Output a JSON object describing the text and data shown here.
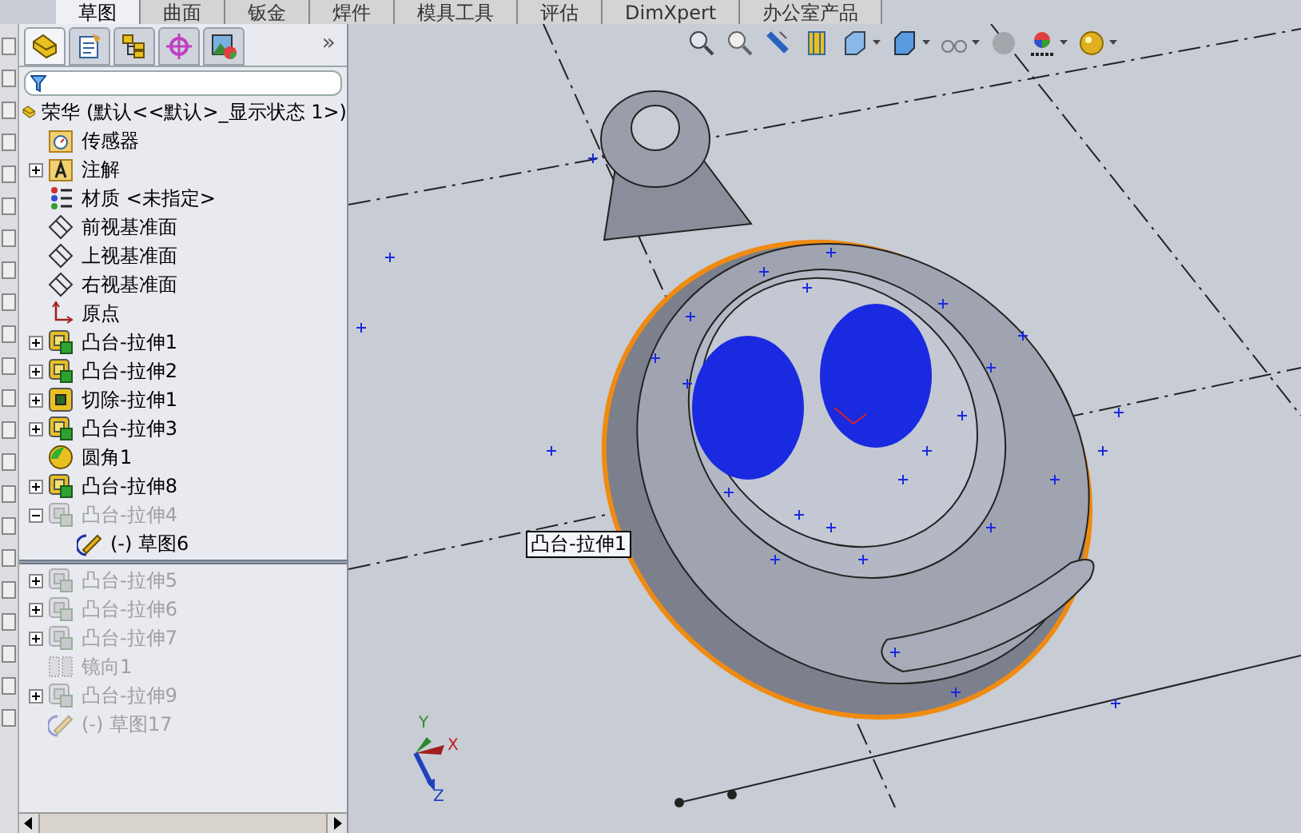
{
  "command_tabs": [
    {
      "label": "草图",
      "selected": true
    },
    {
      "label": "曲面",
      "selected": false
    },
    {
      "label": "钣金",
      "selected": false
    },
    {
      "label": "焊件",
      "selected": false
    },
    {
      "label": "模具工具",
      "selected": false
    },
    {
      "label": "评估",
      "selected": false
    },
    {
      "label": "DimXpert",
      "selected": false
    },
    {
      "label": "办公室产品",
      "selected": false
    }
  ],
  "panel_tabs": [
    {
      "kind": "feature",
      "selected": true
    },
    {
      "kind": "property",
      "selected": false
    },
    {
      "kind": "config",
      "selected": false
    },
    {
      "kind": "dimxpert",
      "selected": false
    },
    {
      "kind": "display",
      "selected": false
    }
  ],
  "panel_more": "»",
  "tree": {
    "label": "荣华 (默认<<默认>_显示状态 1>)",
    "kind": "part",
    "children": [
      {
        "label": "传感器",
        "kind": "sensor",
        "suppressed": false
      },
      {
        "label": "注解",
        "kind": "annotation",
        "expanded": false,
        "suppressed": false
      },
      {
        "label": "材质 <未指定>",
        "kind": "material",
        "suppressed": false
      },
      {
        "label": "前视基准面",
        "kind": "plane",
        "suppressed": false
      },
      {
        "label": "上视基准面",
        "kind": "plane",
        "suppressed": false
      },
      {
        "label": "右视基准面",
        "kind": "plane",
        "suppressed": false
      },
      {
        "label": "原点",
        "kind": "origin",
        "suppressed": false
      },
      {
        "label": "凸台-拉伸1",
        "kind": "boss",
        "expanded": false,
        "suppressed": false
      },
      {
        "label": "凸台-拉伸2",
        "kind": "boss",
        "expanded": false,
        "suppressed": false
      },
      {
        "label": "切除-拉伸1",
        "kind": "cut",
        "expanded": false,
        "suppressed": false
      },
      {
        "label": "凸台-拉伸3",
        "kind": "boss",
        "expanded": false,
        "suppressed": false
      },
      {
        "label": "圆角1",
        "kind": "fillet",
        "suppressed": false
      },
      {
        "label": "凸台-拉伸8",
        "kind": "boss",
        "expanded": false,
        "suppressed": false
      },
      {
        "label": "凸台-拉伸4",
        "kind": "boss",
        "expanded": true,
        "suppressed": true,
        "rollback_bar_after": true,
        "children": [
          {
            "label": "(-) 草图6",
            "kind": "sketch",
            "suppressed": false
          }
        ]
      },
      {
        "label": "凸台-拉伸5",
        "kind": "boss",
        "expanded": false,
        "suppressed": true
      },
      {
        "label": "凸台-拉伸6",
        "kind": "boss",
        "expanded": false,
        "suppressed": true
      },
      {
        "label": "凸台-拉伸7",
        "kind": "boss",
        "expanded": false,
        "suppressed": true
      },
      {
        "label": "镜向1",
        "kind": "mirror",
        "suppressed": true
      },
      {
        "label": "凸台-拉伸9",
        "kind": "boss",
        "expanded": false,
        "suppressed": true
      },
      {
        "label": "(-) 草图17",
        "kind": "sketch",
        "suppressed": true
      }
    ]
  },
  "tooltip": "凸台-拉伸1",
  "triad": {
    "x": "X",
    "y": "Y",
    "z": "Z"
  }
}
